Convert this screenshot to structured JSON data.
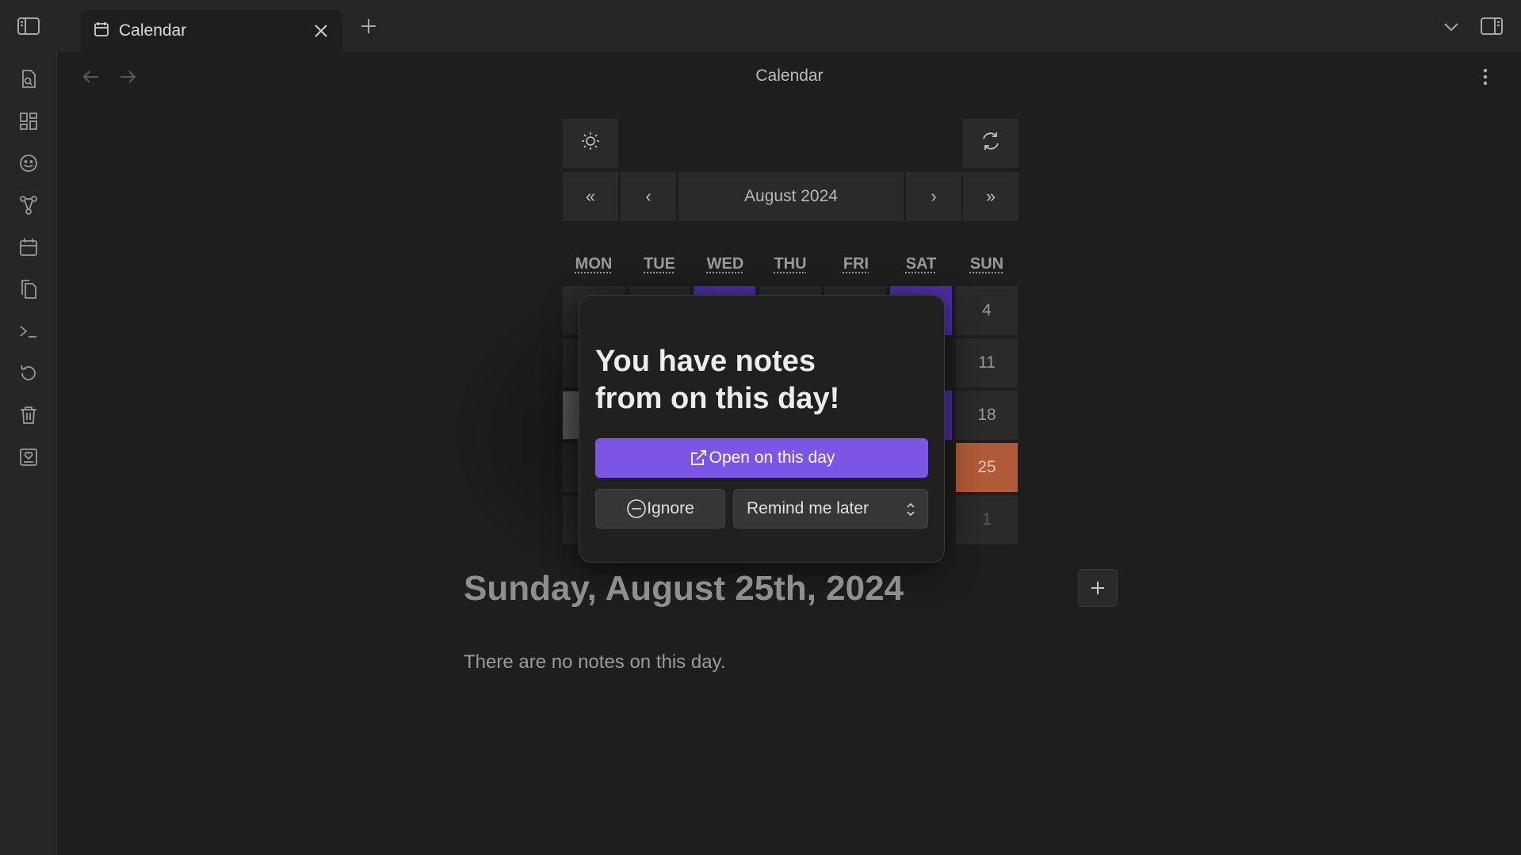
{
  "tab": {
    "title": "Calendar"
  },
  "header": {
    "title": "Calendar"
  },
  "calendar": {
    "month_label": "August 2024",
    "nav": {
      "prev_year": "«",
      "prev_month": "‹",
      "next_month": "›",
      "next_year": "»"
    },
    "weekdays": [
      "MON",
      "TUE",
      "WED",
      "THU",
      "FRI",
      "SAT",
      "SUN"
    ],
    "sunday_column": [
      "4",
      "11",
      "18",
      "25",
      "1"
    ],
    "today": "25"
  },
  "popup": {
    "heading_line1": "You have notes",
    "heading_line2": "from on this day!",
    "open_label": "Open on this day",
    "ignore_label": "Ignore",
    "remind_label": "Remind me later"
  },
  "day_view": {
    "heading": "Sunday, August 25th, 2024",
    "empty_message": "There are no notes on this day."
  },
  "colors": {
    "accent": "#7c55e6",
    "highlight": "#4d2ea2",
    "today": "#b05a38"
  }
}
